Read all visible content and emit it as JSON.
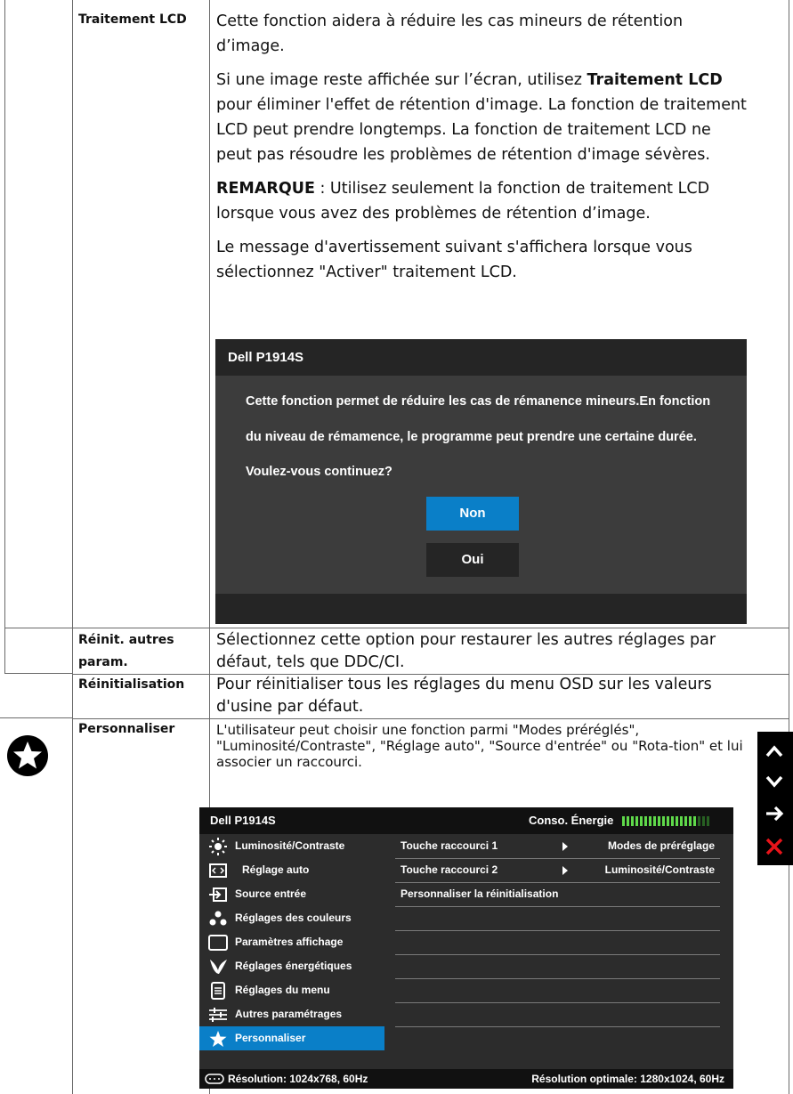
{
  "rows": [
    {
      "label": "Traitement LCD",
      "p1": "Cette fonction aidera à réduire les cas mineurs de rétention d’image.",
      "p2_pre": "Si une image reste affichée sur l’écran, utilisez ",
      "p2_bold": "Traitement LCD",
      "p2_post": " pour éliminer l'effet de rétention d'image. La fonction de traitement LCD peut prendre longtemps. La fonction de traitement LCD ne peut pas résoudre les problèmes de rétention d'image sévères.",
      "p3_bold": "REMARQUE",
      "p3_post": " : Utilisez seulement la fonction de traitement LCD lorsque vous avez des problèmes de rétention d’image.",
      "p4": "Le message d'avertissement suivant s'affichera lorsque vous sélectionnez \"Activer\" traitement LCD."
    },
    {
      "label_line1": "Réinit. autres",
      "label_line2": "param.",
      "text": "Sélectionnez cette option pour restaurer les autres réglages par défaut, tels que DDC/CI."
    },
    {
      "label": "Réinitialisation",
      "text": "Pour réinitialiser tous les réglages du menu OSD sur les valeurs d'usine par défaut."
    },
    {
      "label": "Personnaliser",
      "icon": "star-icon",
      "text": "L'utilisateur peut choisir une fonction parmi \"Modes préréglés\", \"Luminosité/Contraste\", \"Réglage auto\", \"Source d'entrée\" ou \"Rota-tion\" et lui associer un raccourci."
    }
  ],
  "dialog": {
    "title": "Dell P1914S",
    "line1": "Cette fonction permet de réduire les cas de rémanence mineurs.En fonction",
    "line2": "du niveau de rémamence, le programme peut prendre une certaine durée.",
    "line3": "Voulez-vous continuez?",
    "btn_no": "Non",
    "btn_yes": "Oui",
    "colors": {
      "selected": "#0a7fc8",
      "button": "#252525",
      "body": "#3c3c3c"
    }
  },
  "osd": {
    "title": "Dell P1914S",
    "energy_label": "Conso. Énergie",
    "energy_level": 0.85,
    "menu": [
      {
        "label": "Luminosité/Contraste",
        "icon": "brightness-icon"
      },
      {
        "label": "Réglage auto",
        "icon": "auto-adjust-icon"
      },
      {
        "label": "Source entrée",
        "icon": "input-source-icon"
      },
      {
        "label": "Réglages des couleurs",
        "icon": "color-dots-icon"
      },
      {
        "label": "Paramètres affichage",
        "icon": "display-icon"
      },
      {
        "label": "Réglages énergétiques",
        "icon": "energy-leaf-icon"
      },
      {
        "label": "Réglages du menu",
        "icon": "menu-icon"
      },
      {
        "label": "Autres paramétrages",
        "icon": "sliders-icon"
      },
      {
        "label": "Personnaliser",
        "icon": "star-icon",
        "selected": true
      }
    ],
    "rows": [
      {
        "key": "Touche raccourci 1",
        "value": "Modes de préréglage"
      },
      {
        "key": "Touche raccourci 2",
        "value": "Luminosité/Contraste"
      },
      {
        "key": "Personnaliser la réinitialisation",
        "value": ""
      }
    ],
    "resolution": "Résolution: 1024x768,  60Hz",
    "optimal": "Résolution optimale: 1280x1024,  60Hz",
    "accent": "#0a7fc8"
  },
  "nav_buttons": [
    {
      "icon": "up-arrow-icon"
    },
    {
      "icon": "down-arrow-icon"
    },
    {
      "icon": "right-arrow-icon"
    },
    {
      "icon": "close-icon",
      "color": "#e8141a"
    }
  ]
}
